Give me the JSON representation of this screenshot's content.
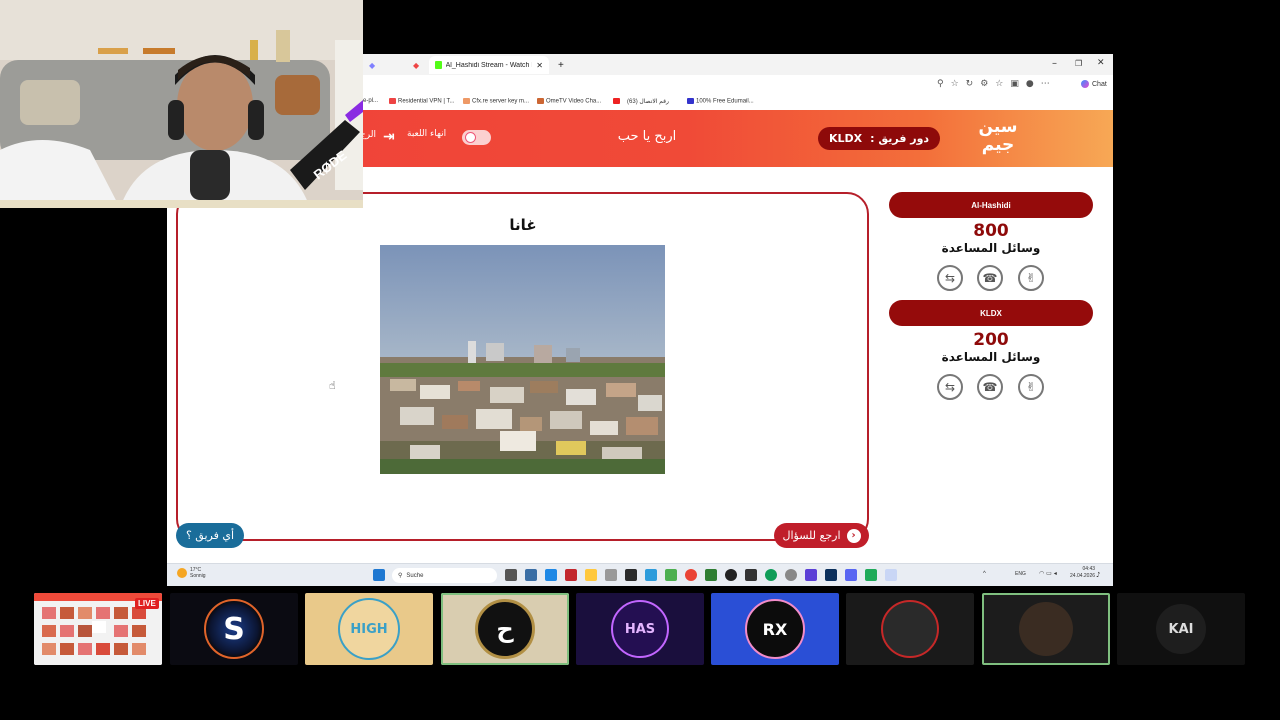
{
  "browser": {
    "tabs": [
      {
        "label": "Al_Hashidi Stream - Watch Live o",
        "icon_color": "#53fc18"
      }
    ],
    "chat_label": "Chat",
    "bookmarks": [
      {
        "label": "Residential VPN | T...",
        "color": "#e44"
      },
      {
        "label": "Cfx.re server key m...",
        "color": "#e96"
      },
      {
        "label": "OmeTV Video Cha...",
        "color": "#c63"
      },
      {
        "label": "رقم الاتصال (63)",
        "color": "#e22"
      },
      {
        "label": "100% Free Edumail...",
        "color": "#33c"
      }
    ]
  },
  "game": {
    "logo_text": "سين جيم",
    "turn_label": "دور فريق :",
    "turn_team": "KLDX",
    "round_title": "اربح يا حب",
    "end_game_label": "انهاء اللعبة",
    "back_label": "الرج",
    "question_country": "غانا",
    "btn_which_team": "أي فريق ؟",
    "btn_back_question": "ارجع للسؤال",
    "teams": [
      {
        "name": "Al-Hashidi",
        "score": "800",
        "aids_label": "وسائل المساعدة",
        "aids": [
          "call-swap-icon",
          "phone-icon",
          "hand-icon"
        ]
      },
      {
        "name": "KLDX",
        "score": "200",
        "aids_label": "وسائل المساعدة",
        "aids": [
          "call-swap-icon",
          "phone-icon",
          "hand-icon"
        ]
      }
    ]
  },
  "taskbar": {
    "weather_temp": "17°C",
    "weather_desc": "Sonnig",
    "search_placeholder": "Suche",
    "lang": "ENG",
    "time": "04:43",
    "date": "24.04.2026"
  },
  "overlay": {
    "live_label": "LIVE"
  },
  "stream_tiles": [
    {
      "label": "S",
      "bg": "#0b0b12",
      "fg": "#fff"
    },
    {
      "label": "HIGH",
      "bg": "#e9c98a",
      "fg": "#3aa0c7"
    },
    {
      "label": "ح",
      "bg": "#d9cdb0",
      "fg": "#111"
    },
    {
      "label": "HAS",
      "bg": "#1a0f3d",
      "fg": "#e4b5ff"
    },
    {
      "label": "RX",
      "bg": "#2a4fd6",
      "fg": "#fff"
    },
    {
      "label": "",
      "bg": "#1a1a1a",
      "fg": "#fff"
    },
    {
      "label": "",
      "bg": "#1c1c1c",
      "fg": "#fff"
    },
    {
      "label": "KAI",
      "bg": "#101010",
      "fg": "#ddd"
    }
  ]
}
